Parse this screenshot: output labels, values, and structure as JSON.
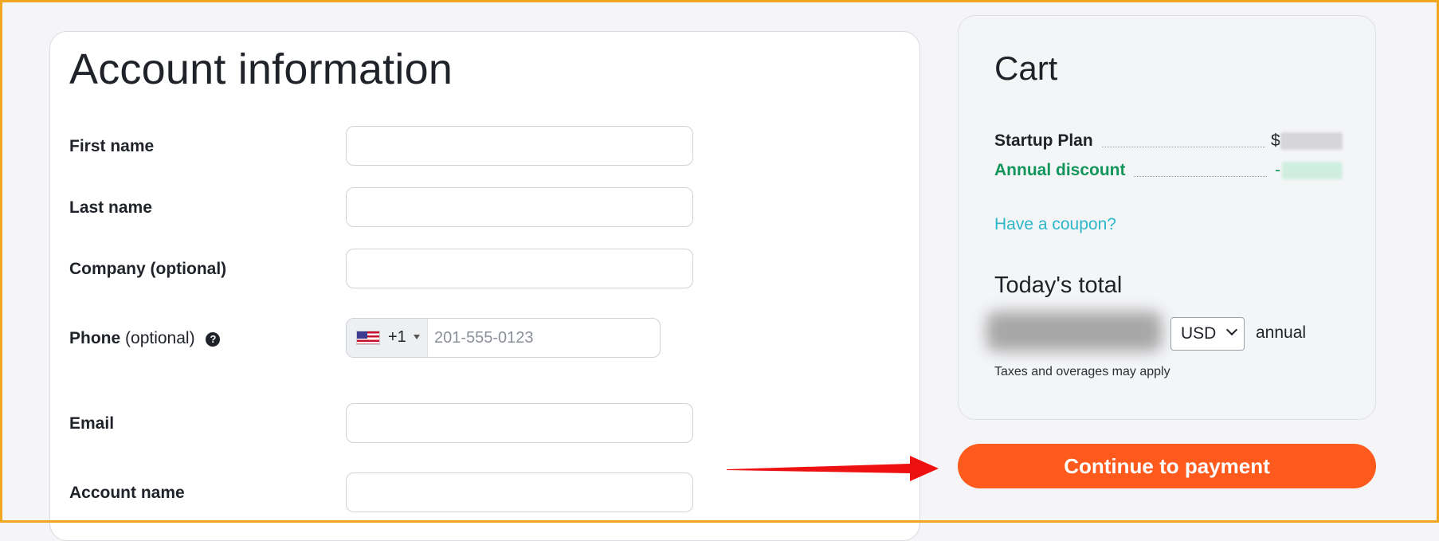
{
  "account": {
    "title": "Account information",
    "fields": {
      "first_name": {
        "label": "First name",
        "value": ""
      },
      "last_name": {
        "label": "Last name",
        "value": ""
      },
      "company": {
        "label": "Company (optional)",
        "value": ""
      },
      "phone": {
        "label": "Phone",
        "label_optional": "(optional)",
        "help_icon": "?",
        "country_flag": "us-flag-icon",
        "dial_code": "+1",
        "placeholder": "201-555-0123",
        "value": ""
      },
      "email": {
        "label": "Email",
        "value": ""
      },
      "account_name": {
        "label": "Account name",
        "value": ""
      }
    }
  },
  "cart": {
    "title": "Cart",
    "items": [
      {
        "name": "Startup Plan",
        "price_visible": "$"
      },
      {
        "name": "Annual discount",
        "price_visible": "-"
      }
    ],
    "coupon_link": "Have a coupon?",
    "total_label": "Today's total",
    "currency": "USD",
    "period": "annual",
    "taxes_note": "Taxes and overages may apply"
  },
  "actions": {
    "continue_label": "Continue to payment"
  },
  "colors": {
    "frame_border": "#f2a51e",
    "primary_button": "#fe5a1d",
    "discount_green": "#12955b",
    "link_teal": "#2cb7c9",
    "annotation_arrow": "#ee1111"
  }
}
